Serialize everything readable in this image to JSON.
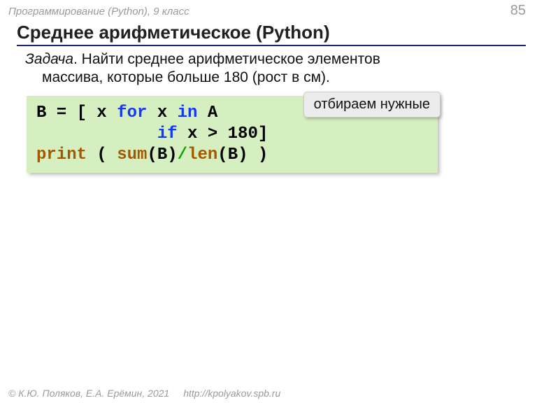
{
  "header": {
    "course": "Программирование (Python), 9 класс",
    "page": "85"
  },
  "title": "Среднее арифметическое (Python)",
  "task": {
    "label": "Задача",
    "dot": ". ",
    "line1_rest": "Найти среднее арифметическое элементов",
    "line2": "массива, которые больше 180 (рост в см)."
  },
  "code": {
    "l1_a": "B = [ x ",
    "l1_for": "for",
    "l1_b": " x ",
    "l1_in": "in",
    "l1_c": " A ",
    "l2_pad": "            ",
    "l2_if": "if",
    "l2_a": " x > 180]",
    "l3_print": "print",
    "l3_a": " ( ",
    "l3_sum": "sum",
    "l3_b": "(B)",
    "l3_slash": "/",
    "l3_len": "len",
    "l3_c": "(B) )"
  },
  "callout": "отбираем нужные",
  "footer": {
    "copyright": "© К.Ю. Поляков, Е.А. Ерёмин, 2021",
    "url": "http://kpolyakov.spb.ru"
  }
}
